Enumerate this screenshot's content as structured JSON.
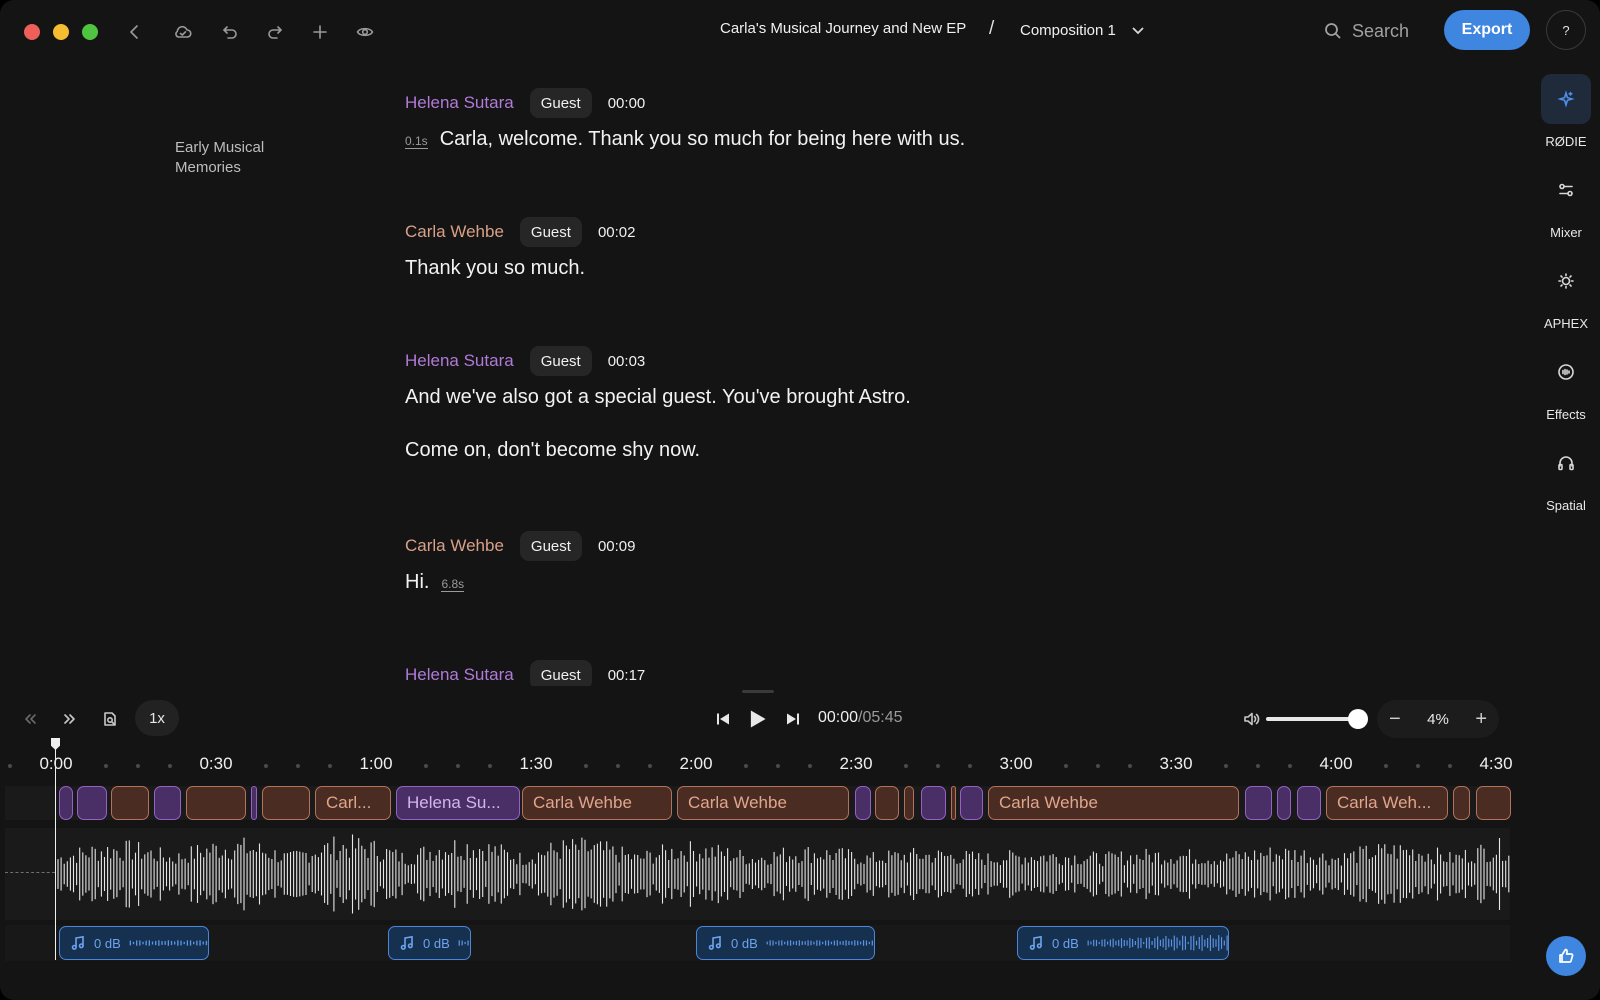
{
  "window": {
    "controls": [
      "close",
      "minimize",
      "maximize"
    ]
  },
  "toolbar": {
    "icons": [
      "back-icon",
      "cloud-sync-icon",
      "undo-icon",
      "redo-icon",
      "add-icon",
      "preview-icon"
    ],
    "project_title": "Carla's Musical Journey and New EP",
    "separator": "/",
    "composition": "Composition 1",
    "search_label": "Search",
    "export_label": "Export",
    "help_label": "?"
  },
  "chapter": {
    "title": "Early Musical Memories"
  },
  "transcript": {
    "segments": [
      {
        "speaker": "Helena Sutara",
        "color": "#b07ad8",
        "role": "Guest",
        "time": "00:00",
        "lines": [
          {
            "gap_before": "0.1s",
            "text": "Carla, welcome. Thank you so much for being here with us."
          }
        ]
      },
      {
        "speaker": "Carla Wehbe",
        "color": "#d9a088",
        "role": "Guest",
        "time": "00:02",
        "lines": [
          {
            "text": "Thank you so much."
          }
        ]
      },
      {
        "speaker": "Helena Sutara",
        "color": "#b07ad8",
        "role": "Guest",
        "time": "00:03",
        "lines": [
          {
            "text": "And we've also got a special guest. You've brought Astro."
          },
          {
            "text": "Come on, don't become shy now."
          }
        ]
      },
      {
        "speaker": "Carla Wehbe",
        "color": "#d9a088",
        "role": "Guest",
        "time": "00:09",
        "lines": [
          {
            "text": "Hi.",
            "gap_after": "6.8s"
          }
        ]
      },
      {
        "speaker": "Helena Sutara",
        "color": "#b07ad8",
        "role": "Guest",
        "time": "00:17",
        "lines": []
      }
    ]
  },
  "rail": {
    "items": [
      {
        "label": "RØDIE",
        "icon": "sparkle-icon",
        "active": true
      },
      {
        "label": "Mixer",
        "icon": "sliders-icon"
      },
      {
        "label": "APHEX",
        "icon": "aphex-icon"
      },
      {
        "label": "Effects",
        "icon": "effects-icon"
      },
      {
        "label": "Spatial",
        "icon": "headphones-icon"
      }
    ]
  },
  "playback": {
    "speed": "1x",
    "current_time": "00:00",
    "duration": "/05:45",
    "volume": 1.0,
    "zoom": "4%",
    "zoom_minus": "−",
    "zoom_plus": "+"
  },
  "timeline": {
    "ticks": [
      "0:00",
      "0:30",
      "1:00",
      "1:30",
      "2:00",
      "2:30",
      "3:00",
      "3:30",
      "4:00",
      "4:30"
    ],
    "speaker_clips": [
      {
        "s": "p",
        "label": ""
      },
      {
        "s": "p",
        "label": ""
      },
      {
        "s": "o",
        "label": ""
      },
      {
        "s": "p",
        "label": ""
      },
      {
        "s": "o",
        "label": ""
      },
      {
        "s": "p",
        "label": ""
      },
      {
        "s": "o",
        "label": ""
      },
      {
        "s": "o",
        "label": "Carl..."
      },
      {
        "s": "p",
        "label": "Helena Su..."
      },
      {
        "s": "o",
        "label": "Carla Wehbe"
      },
      {
        "s": "o",
        "label": "Carla Wehbe"
      },
      {
        "s": "p",
        "label": ""
      },
      {
        "s": "o",
        "label": ""
      },
      {
        "s": "o",
        "label": ""
      },
      {
        "s": "p",
        "label": ""
      },
      {
        "s": "o",
        "label": ""
      },
      {
        "s": "p",
        "label": ""
      },
      {
        "s": "o",
        "label": "Carla Wehbe"
      },
      {
        "s": "p",
        "label": ""
      },
      {
        "s": "p",
        "label": ""
      },
      {
        "s": "p",
        "label": ""
      },
      {
        "s": "o",
        "label": "Carla Weh..."
      },
      {
        "s": "o",
        "label": ""
      },
      {
        "s": "o",
        "label": ""
      }
    ],
    "music_clips": [
      {
        "label": "0 dB"
      },
      {
        "label": "0 dB"
      },
      {
        "label": "0 dB"
      },
      {
        "label": "0 dB"
      }
    ]
  },
  "colors": {
    "accent": "#3e86e0",
    "speaker_purple": "#b07ad8",
    "speaker_orange": "#d9a088"
  }
}
